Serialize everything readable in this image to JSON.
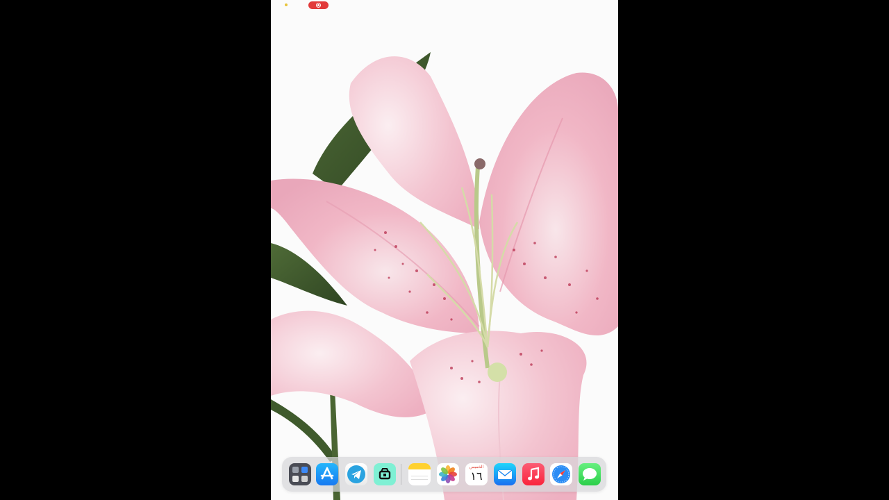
{
  "status_bar": {
    "time": "",
    "right_text": ""
  },
  "dock": {
    "apps": [
      {
        "id": "utilities",
        "icon": "utilities-folder-icon"
      },
      {
        "id": "app-store",
        "icon": "app-store-icon"
      },
      {
        "id": "telegram",
        "icon": "telegram-icon"
      },
      {
        "id": "capcut",
        "icon": "capcut-icon"
      },
      {
        "id": "notes",
        "icon": "notes-icon"
      },
      {
        "id": "photos",
        "icon": "photos-icon"
      },
      {
        "id": "calendar",
        "icon": "calendar-icon",
        "weekday": "الخميس",
        "date": "١٦"
      },
      {
        "id": "mail",
        "icon": "mail-icon"
      },
      {
        "id": "music",
        "icon": "music-icon"
      },
      {
        "id": "safari",
        "icon": "safari-icon"
      },
      {
        "id": "messages",
        "icon": "messages-icon"
      }
    ]
  },
  "colors": {
    "recording_indicator": "#e23a3a",
    "wallpaper_background": "#fbfbfb",
    "petal_pink": "#f2b9c8",
    "letterbox": "#000000"
  },
  "wallpaper": {
    "subject": "pink-lily-flower"
  }
}
